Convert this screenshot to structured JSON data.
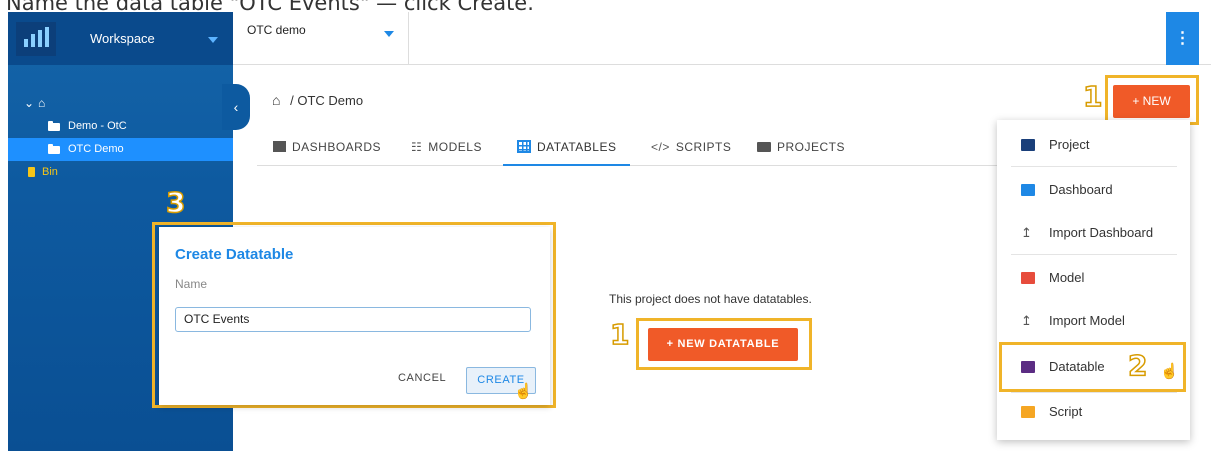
{
  "caption": "Name the data table \"OTC Events\" — click Create.",
  "sidebar": {
    "workspace_label": "Workspace",
    "tree": [
      {
        "label": "Demo - OtC"
      },
      {
        "label": "OTC Demo"
      },
      {
        "label": "Bin"
      }
    ]
  },
  "topbar": {
    "project_name": "OTC demo",
    "kebab": "⋮"
  },
  "breadcrumb": {
    "separator": "/",
    "current": "OTC Demo"
  },
  "tabs": [
    {
      "label": "DASHBOARDS"
    },
    {
      "label": "MODELS"
    },
    {
      "label": "DATATABLES"
    },
    {
      "label": "SCRIPTS"
    },
    {
      "label": "PROJECTS"
    }
  ],
  "empty_state": {
    "message": "This project does not have datatables.",
    "button_label": "+ NEW DATATABLE"
  },
  "new_button_label": "+ NEW",
  "menu": {
    "items": [
      {
        "label": "Project",
        "color": "#1a3f7a"
      },
      {
        "label": "Dashboard",
        "color": "#1e88e5"
      },
      {
        "label": "Import Dashboard"
      },
      {
        "label": "Model",
        "color": "#e74c3c"
      },
      {
        "label": "Import Model"
      },
      {
        "label": "Datatable",
        "color": "#5b2c83"
      },
      {
        "label": "Script",
        "color": "#f5a623"
      }
    ]
  },
  "dialog": {
    "title": "Create Datatable",
    "name_label": "Name",
    "name_value": "OTC Events",
    "cancel_label": "CANCEL",
    "create_label": "CREATE"
  },
  "steps": {
    "one_a": "1",
    "one_b": "1",
    "two": "2",
    "three": "3"
  },
  "colors": {
    "accent_orange": "#f05a28",
    "primary_blue": "#1e88e5",
    "highlight": "#f0b429"
  }
}
